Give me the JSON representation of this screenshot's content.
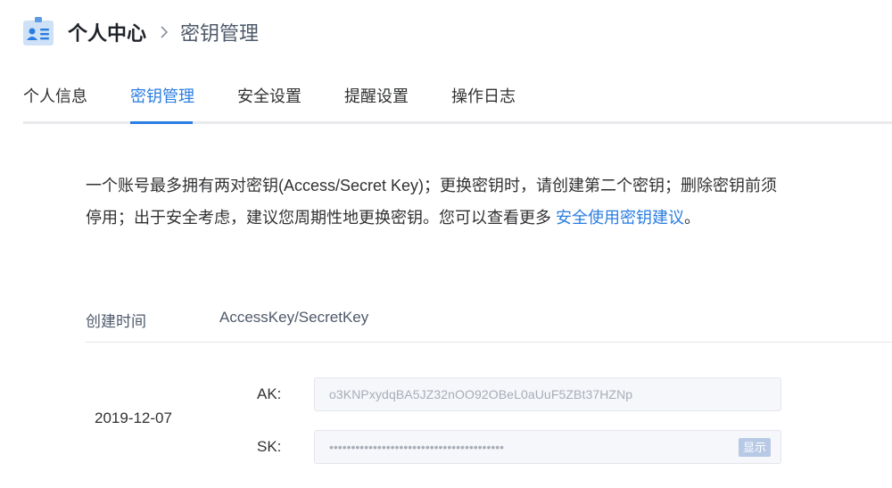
{
  "header": {
    "title": "个人中心",
    "separator": "›",
    "subtitle": "密钥管理"
  },
  "tabs": [
    {
      "label": "个人信息",
      "active": false
    },
    {
      "label": "密钥管理",
      "active": true
    },
    {
      "label": "安全设置",
      "active": false
    },
    {
      "label": "提醒设置",
      "active": false
    },
    {
      "label": "操作日志",
      "active": false
    }
  ],
  "notice": {
    "text": "一个账号最多拥有两对密钥(Access/Secret Key)；更换密钥时，请创建第二个密钥；删除密钥前须停用；出于安全考虑，建议您周期性地更换密钥。您可以查看更多 ",
    "link": "安全使用密钥建议",
    "end": "。"
  },
  "table": {
    "headers": [
      "创建时间",
      "AccessKey/SecretKey"
    ],
    "rows": [
      {
        "created": "2019-12-07",
        "ak_label": "AK:",
        "ak_value": "o3KNPxydqBA5JZ32nOO92OBeL0aUuF5ZBt37HZNp",
        "sk_label": "SK:",
        "sk_value": "••••••••••••••••••••••••••••••••••••••••",
        "show_label": "显示"
      }
    ]
  },
  "colors": {
    "accent": "#2a7de1",
    "text": "#303133",
    "muted": "#a8adb7",
    "button": "#b8c9e6"
  }
}
